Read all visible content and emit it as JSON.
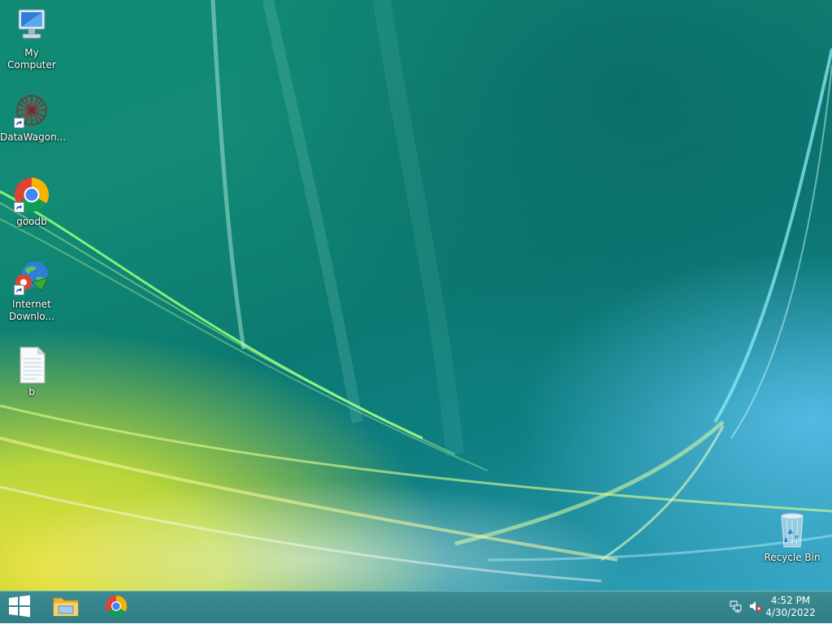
{
  "desktop": {
    "icons": [
      {
        "label": "My Computer",
        "icon": "computer-icon"
      },
      {
        "label": "DataWagon...",
        "icon": "datawagon-icon"
      },
      {
        "label": "goodb",
        "icon": "chrome-icon"
      },
      {
        "label": "Internet\nDownlo...",
        "icon": "internet-download-manager-icon"
      },
      {
        "label": "b",
        "icon": "text-file-icon"
      },
      {
        "label": "Recycle Bin",
        "icon": "recycle-bin-icon"
      }
    ]
  },
  "taskbar": {
    "start": {
      "icon": "windows-logo-icon"
    },
    "pinned": [
      {
        "icon": "file-explorer-icon"
      },
      {
        "icon": "chrome-icon"
      }
    ],
    "tray": {
      "network_icon": "network-icon",
      "volume_icon": "volume-muted-icon",
      "time": "4:52 PM",
      "date": "4/30/2022"
    }
  }
}
